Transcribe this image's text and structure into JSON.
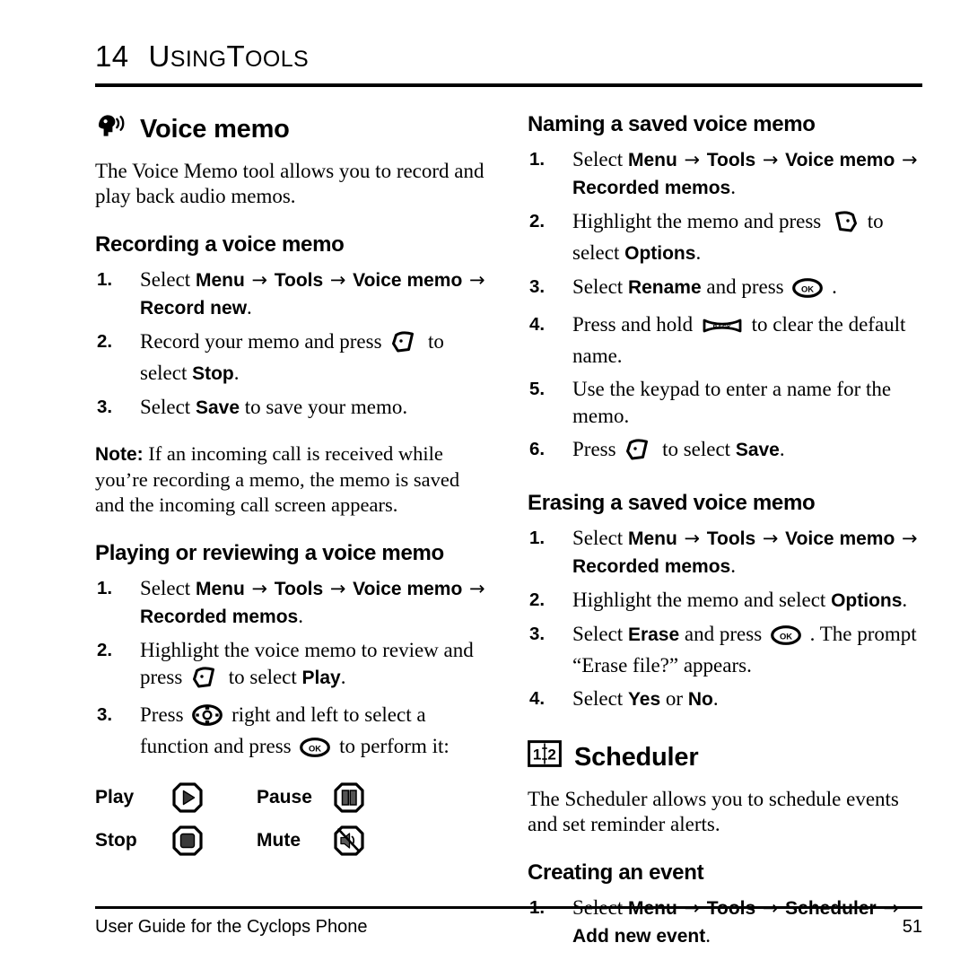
{
  "document": {
    "chapter_number": "14",
    "chapter_title_cap1": "U",
    "chapter_title_rest1": "SING",
    "chapter_title_cap2": "T",
    "chapter_title_rest2": "OOLS",
    "chapter_title_plain": "UsingTools"
  },
  "footer": {
    "left": "User Guide for the Cyclops Phone",
    "page_number": "51"
  },
  "left_column": {
    "voice_memo": {
      "icon": "speaking-head-icon",
      "heading": "Voice memo",
      "intro": "The Voice Memo tool allows you to record and play back audio memos."
    },
    "recording": {
      "heading": "Recording a voice memo",
      "steps": [
        {
          "num": "1.",
          "parts": [
            {
              "t": "text",
              "v": "Select "
            },
            {
              "t": "ui",
              "v": "Menu"
            },
            {
              "t": "arrow",
              "v": "→"
            },
            {
              "t": "ui",
              "v": "Tools"
            },
            {
              "t": "arrow",
              "v": "→"
            },
            {
              "t": "ui",
              "v": "Voice memo"
            },
            {
              "t": "arrow",
              "v": "→"
            },
            {
              "t": "ui",
              "v": "Record new"
            },
            {
              "t": "text",
              "v": "."
            }
          ]
        },
        {
          "num": "2.",
          "parts": [
            {
              "t": "text",
              "v": "Record your memo and press "
            },
            {
              "t": "key",
              "v": "left-softkey-icon"
            },
            {
              "t": "text",
              "v": " to select "
            },
            {
              "t": "ui",
              "v": "Stop"
            },
            {
              "t": "text",
              "v": "."
            }
          ]
        },
        {
          "num": "3.",
          "parts": [
            {
              "t": "text",
              "v": "Select "
            },
            {
              "t": "ui",
              "v": "Save"
            },
            {
              "t": "text",
              "v": " to save your memo."
            }
          ]
        }
      ]
    },
    "note": {
      "label": "Note:",
      "body": "If an incoming call is received while you’re recording a memo, the memo is saved and the incoming call screen appears."
    },
    "playing": {
      "heading": "Playing or reviewing a voice memo",
      "steps": [
        {
          "num": "1.",
          "parts": [
            {
              "t": "text",
              "v": "Select "
            },
            {
              "t": "ui",
              "v": "Menu"
            },
            {
              "t": "arrow",
              "v": "→"
            },
            {
              "t": "ui",
              "v": "Tools"
            },
            {
              "t": "arrow",
              "v": "→"
            },
            {
              "t": "ui",
              "v": "Voice memo"
            },
            {
              "t": "arrow",
              "v": "→"
            },
            {
              "t": "ui",
              "v": "Recorded memos"
            },
            {
              "t": "text",
              "v": "."
            }
          ]
        },
        {
          "num": "2.",
          "parts": [
            {
              "t": "text",
              "v": "Highlight the voice memo to review and press "
            },
            {
              "t": "key",
              "v": "left-softkey-icon"
            },
            {
              "t": "text",
              "v": " to select "
            },
            {
              "t": "ui",
              "v": "Play"
            },
            {
              "t": "text",
              "v": "."
            }
          ]
        },
        {
          "num": "3.",
          "parts": [
            {
              "t": "text",
              "v": "Press "
            },
            {
              "t": "key",
              "v": "navigation-key-icon"
            },
            {
              "t": "text",
              "v": " right and left to select a function and press "
            },
            {
              "t": "key",
              "v": "ok-key-icon"
            },
            {
              "t": "text",
              "v": " to perform it:"
            }
          ]
        }
      ],
      "media_controls": [
        {
          "label": "Play",
          "icon": "play-icon"
        },
        {
          "label": "Pause",
          "icon": "pause-icon"
        },
        {
          "label": "Stop",
          "icon": "stop-icon"
        },
        {
          "label": "Mute",
          "icon": "mute-icon"
        }
      ]
    }
  },
  "right_column": {
    "naming": {
      "heading": "Naming a saved voice memo",
      "steps": [
        {
          "num": "1.",
          "parts": [
            {
              "t": "text",
              "v": "Select "
            },
            {
              "t": "ui",
              "v": "Menu"
            },
            {
              "t": "arrow",
              "v": "→"
            },
            {
              "t": "ui",
              "v": "Tools"
            },
            {
              "t": "arrow",
              "v": "→"
            },
            {
              "t": "ui",
              "v": "Voice memo"
            },
            {
              "t": "arrow",
              "v": "→"
            },
            {
              "t": "ui",
              "v": "Recorded memos"
            },
            {
              "t": "text",
              "v": "."
            }
          ]
        },
        {
          "num": "2.",
          "parts": [
            {
              "t": "text",
              "v": "Highlight the memo and press "
            },
            {
              "t": "key",
              "v": "right-softkey-icon"
            },
            {
              "t": "text",
              "v": " to select "
            },
            {
              "t": "ui",
              "v": "Options"
            },
            {
              "t": "text",
              "v": "."
            }
          ]
        },
        {
          "num": "3.",
          "parts": [
            {
              "t": "text",
              "v": "Select "
            },
            {
              "t": "ui",
              "v": "Rename"
            },
            {
              "t": "text",
              "v": " and press "
            },
            {
              "t": "key",
              "v": "ok-key-icon"
            },
            {
              "t": "text",
              "v": " ."
            }
          ]
        },
        {
          "num": "4.",
          "parts": [
            {
              "t": "text",
              "v": "Press and hold "
            },
            {
              "t": "key",
              "v": "back-key-icon"
            },
            {
              "t": "text",
              "v": " to clear the default name."
            }
          ]
        },
        {
          "num": "5.",
          "parts": [
            {
              "t": "text",
              "v": "Use the keypad to enter a name for the memo."
            }
          ]
        },
        {
          "num": "6.",
          "parts": [
            {
              "t": "text",
              "v": "Press "
            },
            {
              "t": "key",
              "v": "left-softkey-icon"
            },
            {
              "t": "text",
              "v": " to select "
            },
            {
              "t": "ui",
              "v": "Save"
            },
            {
              "t": "text",
              "v": "."
            }
          ]
        }
      ]
    },
    "erasing": {
      "heading": "Erasing a saved voice memo",
      "steps": [
        {
          "num": "1.",
          "parts": [
            {
              "t": "text",
              "v": "Select "
            },
            {
              "t": "ui",
              "v": "Menu"
            },
            {
              "t": "arrow",
              "v": "→"
            },
            {
              "t": "ui",
              "v": "Tools"
            },
            {
              "t": "arrow",
              "v": "→"
            },
            {
              "t": "ui",
              "v": "Voice memo"
            },
            {
              "t": "arrow",
              "v": "→"
            },
            {
              "t": "ui",
              "v": "Recorded memos"
            },
            {
              "t": "text",
              "v": "."
            }
          ]
        },
        {
          "num": "2.",
          "parts": [
            {
              "t": "text",
              "v": "Highlight the memo and select "
            },
            {
              "t": "ui",
              "v": "Options"
            },
            {
              "t": "text",
              "v": "."
            }
          ]
        },
        {
          "num": "3.",
          "parts": [
            {
              "t": "text",
              "v": "Select "
            },
            {
              "t": "ui",
              "v": "Erase"
            },
            {
              "t": "text",
              "v": " and press "
            },
            {
              "t": "key",
              "v": "ok-key-icon"
            },
            {
              "t": "text",
              "v": " . The prompt “Erase file?” appears."
            }
          ]
        },
        {
          "num": "4.",
          "parts": [
            {
              "t": "text",
              "v": "Select "
            },
            {
              "t": "ui",
              "v": "Yes"
            },
            {
              "t": "text",
              "v": " or "
            },
            {
              "t": "ui",
              "v": "No"
            },
            {
              "t": "text",
              "v": "."
            }
          ]
        }
      ]
    },
    "scheduler": {
      "icon": "scheduler-book-icon",
      "icon_page_left": "1",
      "icon_page_right": "2",
      "heading": "Scheduler",
      "intro": "The Scheduler allows you to schedule events and set reminder alerts."
    },
    "creating_event": {
      "heading": "Creating an event",
      "steps": [
        {
          "num": "1.",
          "parts": [
            {
              "t": "text",
              "v": "Select "
            },
            {
              "t": "ui",
              "v": "Menu"
            },
            {
              "t": "arrow",
              "v": "→"
            },
            {
              "t": "ui",
              "v": "Tools"
            },
            {
              "t": "arrow",
              "v": "→"
            },
            {
              "t": "ui",
              "v": "Scheduler"
            },
            {
              "t": "arrow",
              "v": "→"
            },
            {
              "t": "ui",
              "v": "Add new event"
            },
            {
              "t": "text",
              "v": "."
            }
          ]
        }
      ]
    }
  },
  "colors": {
    "text": "#000000",
    "background": "#ffffff",
    "icon_fill": "#3a3a3a"
  }
}
